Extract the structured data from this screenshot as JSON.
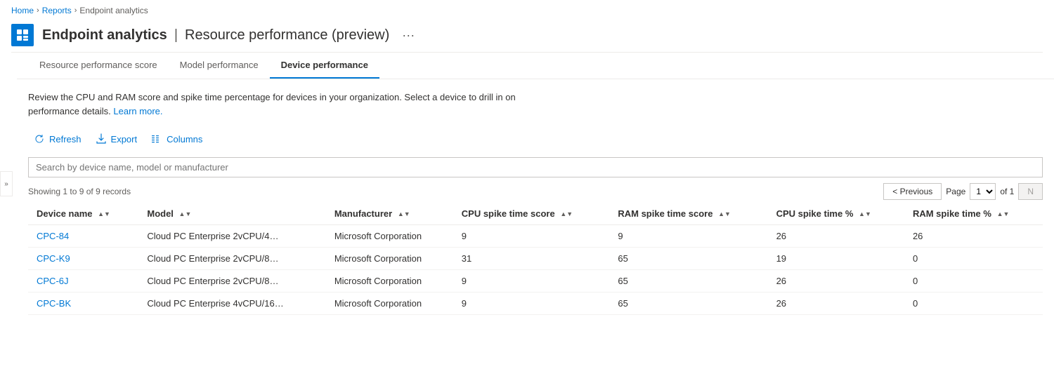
{
  "breadcrumb": {
    "home": "Home",
    "reports": "Reports",
    "current": "Endpoint analytics"
  },
  "header": {
    "title": "Endpoint analytics",
    "separator": "|",
    "subtitle": "Resource performance (preview)",
    "more_label": "···"
  },
  "tabs": [
    {
      "id": "resource-performance-score",
      "label": "Resource performance score",
      "active": false
    },
    {
      "id": "model-performance",
      "label": "Model performance",
      "active": false
    },
    {
      "id": "device-performance",
      "label": "Device performance",
      "active": true
    }
  ],
  "description": {
    "text": "Review the CPU and RAM score and spike time percentage for devices in your organization. Select a device to drill in on performance details.",
    "link_text": "Learn more.",
    "link_href": "#"
  },
  "toolbar": {
    "refresh_label": "Refresh",
    "export_label": "Export",
    "columns_label": "Columns"
  },
  "search": {
    "placeholder": "Search by device name, model or manufacturer"
  },
  "table_meta": {
    "showing": "Showing 1 to 9 of 9 records"
  },
  "pagination": {
    "previous_label": "< Previous",
    "page_label": "Page",
    "page_value": "1",
    "of_label": "of 1",
    "next_label": "N"
  },
  "columns": [
    {
      "id": "device-name",
      "label": "Device name"
    },
    {
      "id": "model",
      "label": "Model"
    },
    {
      "id": "manufacturer",
      "label": "Manufacturer"
    },
    {
      "id": "cpu-spike-time-score",
      "label": "CPU spike time score"
    },
    {
      "id": "ram-spike-time-score",
      "label": "RAM spike time score"
    },
    {
      "id": "cpu-spike-time-pct",
      "label": "CPU spike time %"
    },
    {
      "id": "ram-spike-time-pct",
      "label": "RAM spike time %"
    }
  ],
  "rows": [
    {
      "device_name": "CPC-84",
      "model": "Cloud PC Enterprise 2vCPU/4…",
      "manufacturer": "Microsoft Corporation",
      "cpu_spike_score": "9",
      "ram_spike_score": "9",
      "cpu_spike_pct": "26",
      "ram_spike_pct": "26"
    },
    {
      "device_name": "CPC-K9",
      "model": "Cloud PC Enterprise 2vCPU/8…",
      "manufacturer": "Microsoft Corporation",
      "cpu_spike_score": "31",
      "ram_spike_score": "65",
      "cpu_spike_pct": "19",
      "ram_spike_pct": "0"
    },
    {
      "device_name": "CPC-6J",
      "model": "Cloud PC Enterprise 2vCPU/8…",
      "manufacturer": "Microsoft Corporation",
      "cpu_spike_score": "9",
      "ram_spike_score": "65",
      "cpu_spike_pct": "26",
      "ram_spike_pct": "0"
    },
    {
      "device_name": "CPC-BK",
      "model": "Cloud PC Enterprise 4vCPU/16…",
      "manufacturer": "Microsoft Corporation",
      "cpu_spike_score": "9",
      "ram_spike_score": "65",
      "cpu_spike_pct": "26",
      "ram_spike_pct": "0"
    }
  ],
  "colors": {
    "accent": "#0078d4",
    "border": "#edebe9",
    "text_secondary": "#605e5c"
  }
}
